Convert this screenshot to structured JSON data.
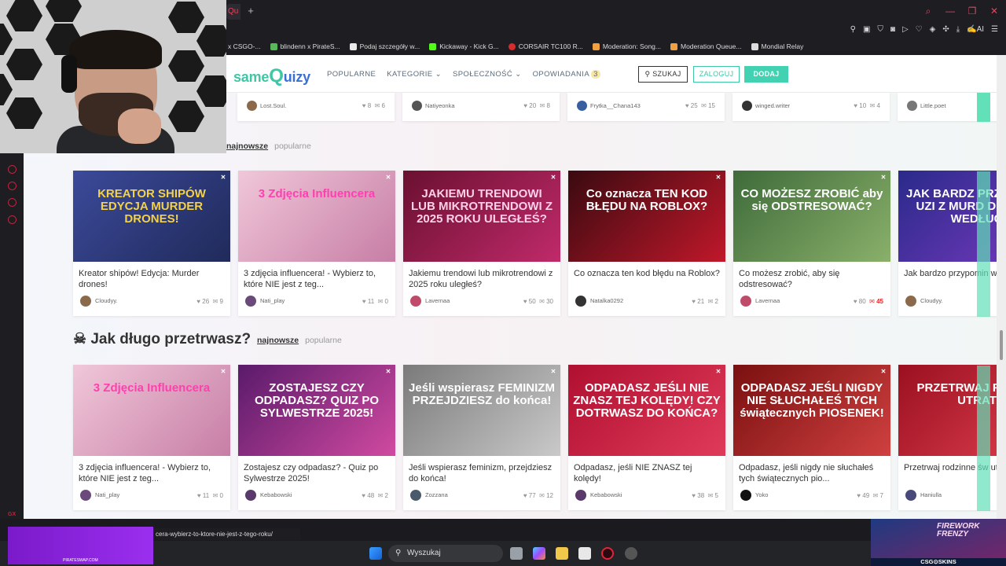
{
  "browser": {
    "tab_fragment": "Qu",
    "new_tab": "+",
    "bookmarks": [
      {
        "label": "x CSGO-...",
        "color": "#444"
      },
      {
        "label": "blindenn x PirateS...",
        "color": "#57b85a"
      },
      {
        "label": "Podaj szczegóły w...",
        "color": "#e9e9e9"
      },
      {
        "label": "Kickaway - Kick G...",
        "color": "#53fc18"
      },
      {
        "label": "CORSAIR TC100 R...",
        "color": "#d82c2c"
      },
      {
        "label": "Moderation: Song...",
        "color": "#f0a040"
      },
      {
        "label": "Moderation Queue...",
        "color": "#f0a040"
      },
      {
        "label": "Mondial Relay",
        "color": "#dddddd"
      }
    ],
    "status_url": "cera-wybierz-to-ktore-nie-jest-z-tego-roku/"
  },
  "site": {
    "logo_same": "same",
    "logo_q": "Q",
    "logo_uizy": "uizy",
    "nav": {
      "popularne": "POPULARNE",
      "kategorie": "KATEGORIE",
      "spolecznosc": "SPOŁECZNOŚĆ",
      "opowiadania": "OPOWIADANIA",
      "opowiadania_badge": "3"
    },
    "search_button": "SZUKAJ",
    "login_button": "ZALOGUJ",
    "add_button": "DODAJ"
  },
  "top_row": [
    {
      "author": "Lost.Soul.",
      "likes": "8",
      "comments": "6",
      "avatar": "#8a6a4a"
    },
    {
      "author": "Natiyeonka",
      "likes": "20",
      "comments": "8",
      "avatar": "#555"
    },
    {
      "author": "Frytka__Chana143",
      "likes": "25",
      "comments": "15",
      "avatar": "#3a5fa0"
    },
    {
      "author": "winged.writer",
      "likes": "10",
      "comments": "4",
      "avatar": "#333"
    },
    {
      "author": "Little.poet",
      "likes": "",
      "comments": "",
      "avatar": "#777"
    }
  ],
  "section1": {
    "tab_new": "najnowsze",
    "tab_popular": "popularne",
    "cards": [
      {
        "title": "Kreator shipów! Edycja: Murder drones!",
        "author": "Cloudyy.",
        "likes": "26",
        "comments": "9",
        "hot": false,
        "thumb_text": "KREATOR SHIPÓW EDYCJA MURDER DRONES!",
        "bg": "linear-gradient(135deg,#3b4a9a,#202a5a)",
        "fg": "#f3d24a",
        "avatar": "#8a6a4a"
      },
      {
        "title": "3 zdjęcia influencera! - Wybierz to, które NIE jest z teg...",
        "author": "Nati_play",
        "likes": "11",
        "comments": "0",
        "hot": false,
        "thumb_text": "3 Zdjęcia Influencera",
        "bg": "linear-gradient(135deg,#f0c7d9,#c77ea5)",
        "fg": "#ff3fb0",
        "avatar": "#6a4a7a"
      },
      {
        "title": "Jakiemu trendowi lub mikrotrendowi z 2025 roku uległeś?",
        "author": "Lavernaa",
        "likes": "50",
        "comments": "30",
        "hot": false,
        "thumb_text": "JAKIEMU TRENDOWI LUB MIKROTRENDOWI Z 2025 ROKU ULEGŁEŚ?",
        "bg": "linear-gradient(135deg,#6a1030,#c02a6a)",
        "fg": "#ffd0e8",
        "avatar": "#c04a6a"
      },
      {
        "title": "Co oznacza ten kod błędu na Roblox?",
        "author": "Natalka0292",
        "likes": "21",
        "comments": "2",
        "hot": false,
        "thumb_text": "Co oznacza TEN KOD BŁĘDU NA ROBLOX?",
        "bg": "linear-gradient(135deg,#3a0a10,#c0182a)",
        "fg": "#ffffff",
        "avatar": "#333"
      },
      {
        "title": "Co możesz zrobić, aby się odstresować?",
        "author": "Lavernaa",
        "likes": "80",
        "comments": "45",
        "hot": true,
        "thumb_text": "CO MOŻESZ ZROBIĆ aby się ODSTRESOWAĆ?",
        "bg": "linear-gradient(135deg,#3e6b3a,#8ab06a)",
        "fg": "#ffffff",
        "avatar": "#c04a6a"
      },
      {
        "title": "Jak bardzo przypomin według AI?",
        "author": "Cloudyy.",
        "likes": "",
        "comments": "",
        "hot": false,
        "thumb_text": "JAK BARDZ PRZYPOMIN UZI Z MURD DRONES WEDŁUG",
        "bg": "linear-gradient(135deg,#2a2a8a,#7a3ac0)",
        "fg": "#ffffff",
        "avatar": "#8a6a4a"
      }
    ]
  },
  "section2": {
    "icon": "☠",
    "title": "Jak długo przetrwasz?",
    "tab_new": "najnowsze",
    "tab_popular": "popularne",
    "cards": [
      {
        "title": "3 zdjęcia influencera! - Wybierz to, które NIE jest z teg...",
        "author": "Nati_play",
        "likes": "11",
        "comments": "0",
        "hot": false,
        "thumb_text": "3 Zdjęcia Influencera",
        "bg": "linear-gradient(135deg,#f0c7d9,#c77ea5)",
        "fg": "#ff3fb0",
        "avatar": "#6a4a7a"
      },
      {
        "title": "Zostajesz czy odpadasz? - Quiz po Sylwestrze 2025!",
        "author": "Kebabowski",
        "likes": "48",
        "comments": "2",
        "hot": false,
        "thumb_text": "ZOSTAJESZ CZY ODPADASZ? QUIZ PO SYLWESTRZE 2025!",
        "bg": "linear-gradient(135deg,#5a1a6a,#d04aa0)",
        "fg": "#ffffff",
        "avatar": "#5a3a6a"
      },
      {
        "title": "Jeśli wspierasz feminizm, przejdziesz do końca!",
        "author": "Zozzana",
        "likes": "77",
        "comments": "12",
        "hot": false,
        "thumb_text": "Jeśli wspierasz FEMINIZM PRZEJDZIESZ do końca!",
        "bg": "linear-gradient(135deg,#7a7a7a,#c9c9c9)",
        "fg": "#ffffff",
        "avatar": "#4a5a6a"
      },
      {
        "title": "Odpadasz, jeśli NIE ZNASZ tej kolędy!",
        "author": "Kebabowski",
        "likes": "38",
        "comments": "5",
        "hot": false,
        "thumb_text": "ODPADASZ JEŚLI NIE ZNASZ TEJ KOLĘDY! CZY DOTRWASZ DO KOŃCA?",
        "bg": "linear-gradient(135deg,#b01030,#e03a5a)",
        "fg": "#ffffff",
        "avatar": "#5a3a6a"
      },
      {
        "title": "Odpadasz, jeśli nigdy nie słuchałeś tych świątecznych pio...",
        "author": "Yoko",
        "likes": "49",
        "comments": "7",
        "hot": false,
        "thumb_text": "ODPADASZ JEŚLI NIGDY NIE SŁUCHAŁEŚ TYCH świątecznych PIOSENEK!",
        "bg": "linear-gradient(135deg,#7a1010,#d04040)",
        "fg": "#ffffff",
        "avatar": "#111"
      },
      {
        "title": "Przetrwaj rodzinne św utraty nerwów!",
        "author": "Haniulla",
        "likes": "",
        "comments": "",
        "hot": false,
        "thumb_text": "PRZETRWAJ RO BEZ UTRAT",
        "bg": "linear-gradient(135deg,#9a1020,#e04050)",
        "fg": "#ffffff",
        "avatar": "#4a4a7a"
      }
    ]
  },
  "taskbar": {
    "search_placeholder": "Wyszukaj"
  },
  "promos": {
    "left_label": "PIRATESWAP.COM",
    "right_title": "FIREWORK FRENZY",
    "right_brand": "CSG⊙SKINS"
  }
}
